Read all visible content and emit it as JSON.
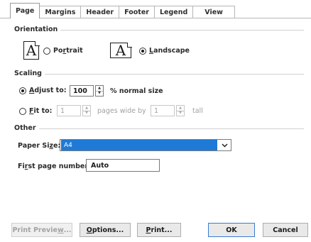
{
  "tabs": [
    {
      "label": "Page",
      "active": true
    },
    {
      "label": "Margins",
      "active": false
    },
    {
      "label": "Header",
      "active": false
    },
    {
      "label": "Footer",
      "active": false
    },
    {
      "label": "Legend",
      "active": false
    },
    {
      "label": "View",
      "active": false
    }
  ],
  "orientation": {
    "group_label": "Orientation",
    "portrait_label": "Portrait",
    "landscape_label": "Landscape",
    "portrait_icon_glyph": "A",
    "landscape_icon_glyph": "A",
    "selected": "landscape"
  },
  "scaling": {
    "group_label": "Scaling",
    "adjust_to_label": "Adjust to:",
    "adjust_to_value": "100",
    "normal_size_suffix": "% normal size",
    "fit_to_label": "Fit to:",
    "pages_wide_value": "1",
    "pages_wide_label": "pages wide by",
    "tall_value": "1",
    "tall_label": "tall",
    "selected": "adjust"
  },
  "other": {
    "group_label": "Other",
    "paper_size_label": "Paper Size:",
    "paper_size_value": "A4",
    "first_page_label": "First page number:",
    "first_page_value": "Auto"
  },
  "buttons": {
    "print_preview": "Print Preview...",
    "options": "Options...",
    "print": "Print...",
    "ok": "OK",
    "cancel": "Cancel"
  },
  "icons": {
    "spin_up": "up-arrow-icon",
    "spin_down": "down-arrow-icon",
    "dropdown": "chevron-down-icon"
  },
  "colors": {
    "selection_blue": "#1e7ad6",
    "focus_border": "#3a7bd5"
  }
}
